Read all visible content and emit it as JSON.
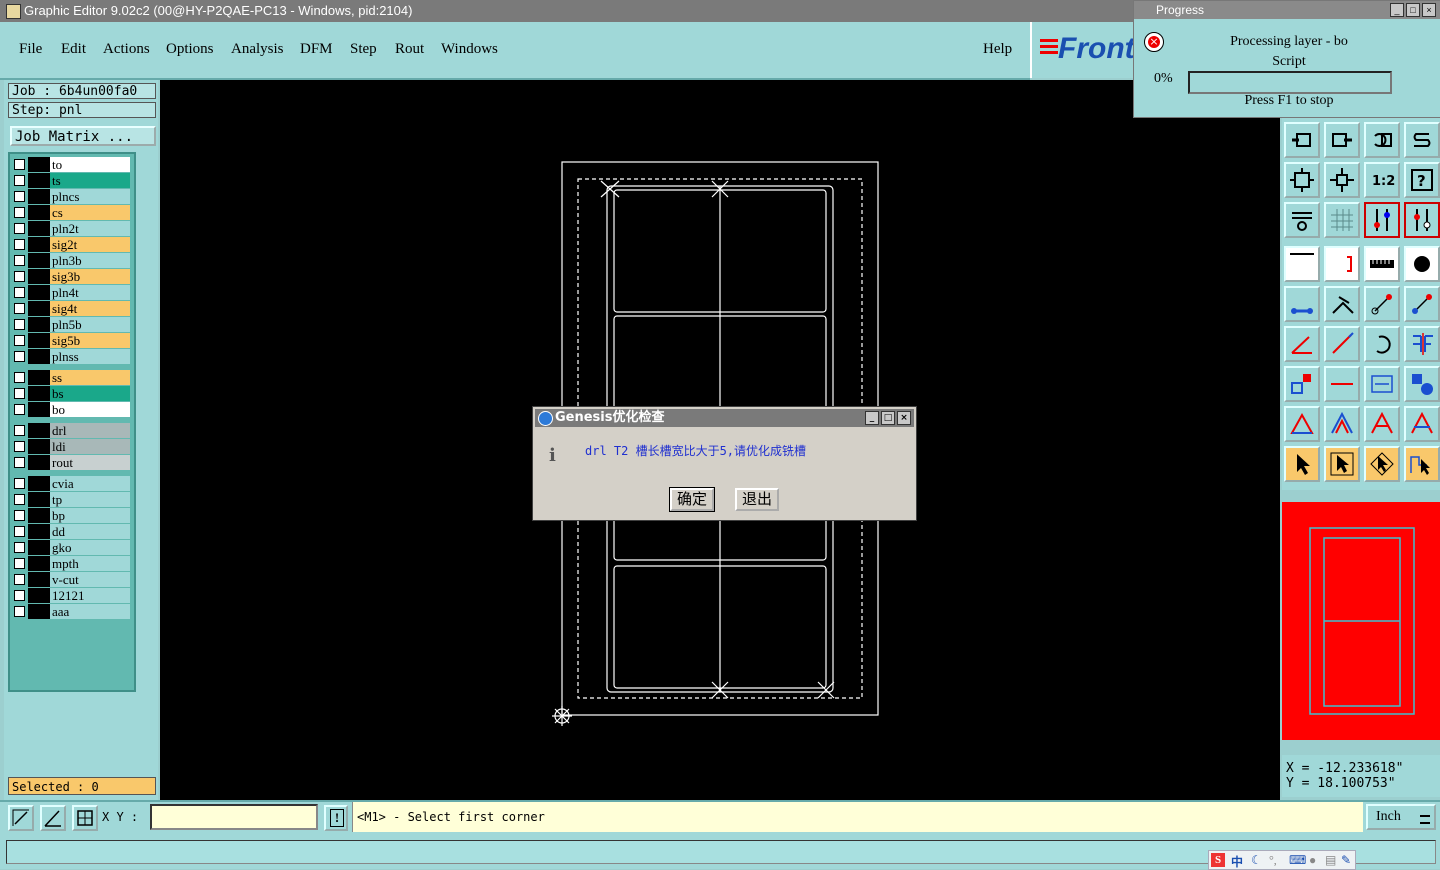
{
  "titlebar": {
    "title": "Graphic Editor 9.02c2 (00@HY-P2QAE-PC13 - Windows, pid:2104)"
  },
  "menu": {
    "items": [
      "File",
      "Edit",
      "Actions",
      "Options",
      "Analysis",
      "DFM",
      "Step",
      "Rout",
      "Windows"
    ],
    "help": "Help"
  },
  "logo": {
    "text": "Front"
  },
  "job": {
    "job_label": "Job  :  6b4un00fa0",
    "step_label": "Step: pnl",
    "matrix_button": "Job Matrix ..."
  },
  "layers": [
    {
      "name": "to",
      "color": "#ffffff"
    },
    {
      "name": "ts",
      "color": "#1aa88a"
    },
    {
      "name": "plncs",
      "color": "#a0d8d8"
    },
    {
      "name": "cs",
      "color": "#f9c86b"
    },
    {
      "name": "pln2t",
      "color": "#a0d8d8"
    },
    {
      "name": "sig2t",
      "color": "#f9c86b"
    },
    {
      "name": "pln3b",
      "color": "#a0d8d8"
    },
    {
      "name": "sig3b",
      "color": "#f9c86b"
    },
    {
      "name": "pln4t",
      "color": "#a0d8d8"
    },
    {
      "name": "sig4t",
      "color": "#f9c86b"
    },
    {
      "name": "pln5b",
      "color": "#a0d8d8"
    },
    {
      "name": "sig5b",
      "color": "#f9c86b"
    },
    {
      "name": "plnss",
      "color": "#a0d8d8"
    },
    {
      "name": "ss",
      "color": "#f9c86b"
    },
    {
      "name": "bs",
      "color": "#1aa88a"
    },
    {
      "name": "bo",
      "color": "#ffffff"
    },
    {
      "name": "drl",
      "color": "#a8b8b8"
    },
    {
      "name": "ldi",
      "color": "#a8b8b8"
    },
    {
      "name": "rout",
      "color": "#c8d0d0"
    },
    {
      "name": "cvia",
      "color": "#a0d8d8"
    },
    {
      "name": "tp",
      "color": "#a0d8d8"
    },
    {
      "name": "bp",
      "color": "#a0d8d8"
    },
    {
      "name": "dd",
      "color": "#a0d8d8"
    },
    {
      "name": "gko",
      "color": "#a0d8d8"
    },
    {
      "name": "mpth",
      "color": "#a0d8d8"
    },
    {
      "name": "v-cut",
      "color": "#a0d8d8"
    },
    {
      "name": "12121",
      "color": "#a0d8d8"
    },
    {
      "name": "aaa",
      "color": "#a0d8d8"
    }
  ],
  "selected": {
    "label": "Selected : 0"
  },
  "progress": {
    "title": "Progress",
    "line1": "Processing layer - bo",
    "line2": "Script",
    "percent_text": "0%",
    "percent_value": 0,
    "hint": "Press F1 to stop"
  },
  "dialog": {
    "title": "Genesis优化检查",
    "message": "drl T2 槽长槽宽比大于5,请优化成铣槽",
    "ok": "确定",
    "exit": "退出"
  },
  "coords": {
    "x": "X = -12.233618\"",
    "y": "Y = 18.100753\""
  },
  "bottom": {
    "xy_label": "X Y :",
    "xy_value": "",
    "prompt": "<M1> - Select first corner",
    "units": "Inch"
  },
  "tray": {
    "zh": "中"
  }
}
